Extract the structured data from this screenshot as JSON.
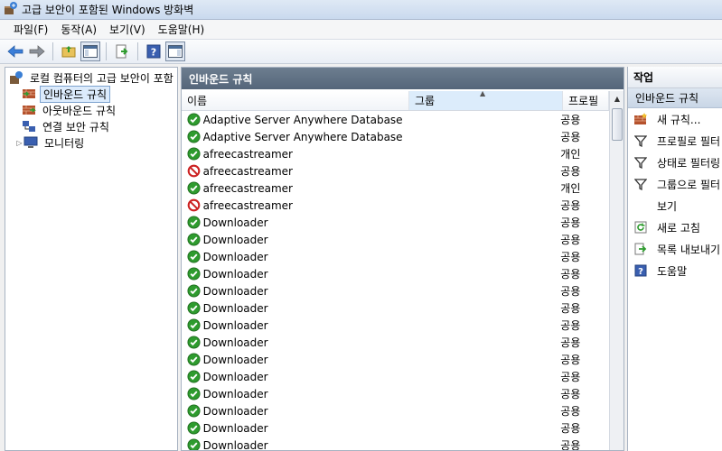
{
  "window": {
    "title": "고급 보안이 포함된 Windows 방화벽"
  },
  "menu": [
    "파일(F)",
    "동작(A)",
    "보기(V)",
    "도움말(H)"
  ],
  "tree": {
    "root": "로컬 컴퓨터의 고급 보안이 포함",
    "items": [
      "인바운드 규칙",
      "아웃바운드 규칙",
      "연결 보안 규칙",
      "모니터링"
    ]
  },
  "list": {
    "header": "인바운드 규칙",
    "columns": {
      "name": "이름",
      "group": "그룹",
      "profile": "프로필"
    },
    "rows": [
      {
        "name": "Adaptive Server Anywhere Database En...",
        "group": "",
        "profile": "공용",
        "status": "allow"
      },
      {
        "name": "Adaptive Server Anywhere Database En...",
        "group": "",
        "profile": "공용",
        "status": "allow"
      },
      {
        "name": "afreecastreamer",
        "group": "",
        "profile": "개인",
        "status": "allow"
      },
      {
        "name": "afreecastreamer",
        "group": "",
        "profile": "공용",
        "status": "block"
      },
      {
        "name": "afreecastreamer",
        "group": "",
        "profile": "개인",
        "status": "allow"
      },
      {
        "name": "afreecastreamer",
        "group": "",
        "profile": "공용",
        "status": "block"
      },
      {
        "name": "Downloader",
        "group": "",
        "profile": "공용",
        "status": "allow"
      },
      {
        "name": "Downloader",
        "group": "",
        "profile": "공용",
        "status": "allow"
      },
      {
        "name": "Downloader",
        "group": "",
        "profile": "공용",
        "status": "allow"
      },
      {
        "name": "Downloader",
        "group": "",
        "profile": "공용",
        "status": "allow"
      },
      {
        "name": "Downloader",
        "group": "",
        "profile": "공용",
        "status": "allow"
      },
      {
        "name": "Downloader",
        "group": "",
        "profile": "공용",
        "status": "allow"
      },
      {
        "name": "Downloader",
        "group": "",
        "profile": "공용",
        "status": "allow"
      },
      {
        "name": "Downloader",
        "group": "",
        "profile": "공용",
        "status": "allow"
      },
      {
        "name": "Downloader",
        "group": "",
        "profile": "공용",
        "status": "allow"
      },
      {
        "name": "Downloader",
        "group": "",
        "profile": "공용",
        "status": "allow"
      },
      {
        "name": "Downloader",
        "group": "",
        "profile": "공용",
        "status": "allow"
      },
      {
        "name": "Downloader",
        "group": "",
        "profile": "공용",
        "status": "allow"
      },
      {
        "name": "Downloader",
        "group": "",
        "profile": "공용",
        "status": "allow"
      },
      {
        "name": "Downloader",
        "group": "",
        "profile": "공용",
        "status": "allow"
      }
    ]
  },
  "actions": {
    "header": "작업",
    "section": "인바운드 규칙",
    "items": [
      {
        "label": "새 규칙...",
        "icon": "new-rule-icon"
      },
      {
        "label": "프로필로 필터",
        "icon": "filter-icon"
      },
      {
        "label": "상태로 필터링",
        "icon": "filter-icon"
      },
      {
        "label": "그룹으로 필터",
        "icon": "filter-icon"
      },
      {
        "label": "보기",
        "icon": ""
      },
      {
        "label": "새로 고침",
        "icon": "refresh-icon"
      },
      {
        "label": "목록 내보내기",
        "icon": "export-icon"
      },
      {
        "label": "도움말",
        "icon": "help-icon"
      }
    ]
  },
  "colors": {
    "allow": "#2e9b2e",
    "block": "#cc2222",
    "header_bg": "#5e6e82",
    "selection": "#dcebfc"
  }
}
